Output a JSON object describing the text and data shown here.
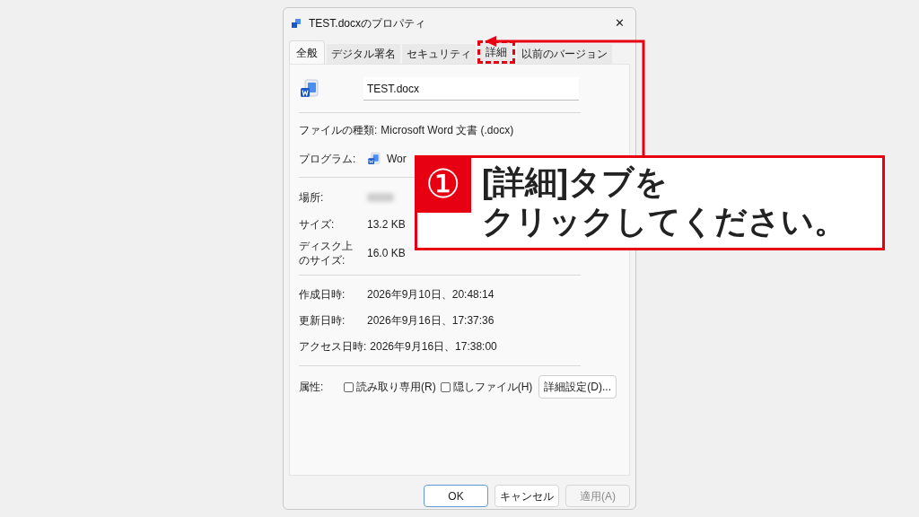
{
  "window": {
    "title": "TEST.docxのプロパティ",
    "close": "✕"
  },
  "tabs": [
    {
      "label": "全般",
      "selected": true,
      "highlighted": false
    },
    {
      "label": "デジタル署名",
      "selected": false,
      "highlighted": false
    },
    {
      "label": "セキュリティ",
      "selected": false,
      "highlighted": false
    },
    {
      "label": "詳細",
      "selected": false,
      "highlighted": true
    },
    {
      "label": "以前のバージョン",
      "selected": false,
      "highlighted": false
    }
  ],
  "file_name": {
    "value": "TEST.docx"
  },
  "file_type": {
    "label": "ファイルの種類:",
    "value": "Microsoft Word 文書 (.docx)"
  },
  "program": {
    "label": "プログラム:",
    "value": "Wor"
  },
  "location": {
    "label": "場所:"
  },
  "size": {
    "label": "サイズ:",
    "value": "13.2 KB"
  },
  "size_on_disk": {
    "label": "ディスク上のサイズ:",
    "value": "16.0 KB"
  },
  "dates": [
    {
      "label": "作成日時:",
      "value": "2026年9月10日、20:48:14"
    },
    {
      "label": "更新日時:",
      "value": "2026年9月16日、17:37:36"
    },
    {
      "label": "アクセス日時:",
      "value": "2026年9月16日、17:38:00"
    }
  ],
  "attributes": {
    "label": "属性:",
    "checkboxes": [
      {
        "label": "読み取り専用(R)",
        "checked": false
      },
      {
        "label": "隠しファイル(H)",
        "checked": false
      }
    ],
    "button": "詳細設定(D)..."
  },
  "buttons": [
    {
      "label": "OK",
      "disabled": false,
      "default": true
    },
    {
      "label": "キャンセル",
      "disabled": false,
      "default": false
    },
    {
      "label": "適用(A)",
      "disabled": true,
      "default": false
    }
  ],
  "callout": {
    "number": "①",
    "lines": [
      "[詳細]タブを",
      "クリックしてください。"
    ]
  }
}
